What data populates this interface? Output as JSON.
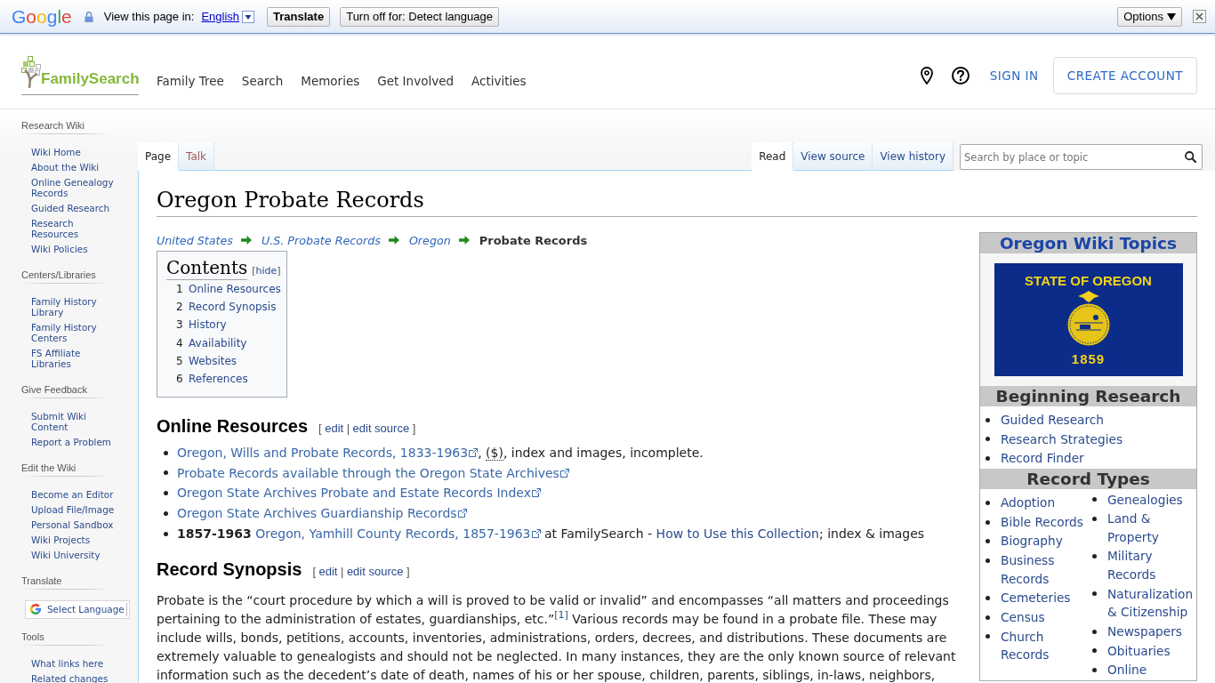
{
  "translate_bar": {
    "logo": "Google",
    "prompt": "View this page in:",
    "language": "English",
    "buttons": [
      {
        "label": "Translate",
        "kind": "translate"
      },
      {
        "label": "Turn off for: Detect language",
        "kind": "turn_off"
      }
    ],
    "options": "Options"
  },
  "header": {
    "logo": "FamilySearch",
    "nav": [
      "Family Tree",
      "Search",
      "Memories",
      "Get Involved",
      "Activities"
    ],
    "sign_in": "SIGN IN",
    "create_account": "CREATE ACCOUNT"
  },
  "sidebar": [
    {
      "heading": "Research Wiki",
      "kind": "links",
      "links": [
        "Wiki Home",
        "About the Wiki",
        "Online Genealogy Records",
        "Guided Research",
        "Research Resources",
        "Wiki Policies"
      ]
    },
    {
      "heading": "Centers/Libraries",
      "kind": "links",
      "links": [
        "Family History Library",
        "Family History Centers",
        "FS Affiliate Libraries"
      ]
    },
    {
      "heading": "Give Feedback",
      "kind": "links",
      "links": [
        "Submit Wiki Content",
        "Report a Problem"
      ]
    },
    {
      "heading": "Edit the Wiki",
      "kind": "links",
      "links": [
        "Become an Editor",
        "Upload File/Image",
        "Personal Sandbox",
        "Wiki Projects",
        "Wiki University"
      ]
    },
    {
      "heading": "Translate",
      "kind": "language_select",
      "label": "Select Language"
    },
    {
      "heading": "Tools",
      "kind": "links",
      "links": [
        "What links here",
        "Related changes"
      ]
    }
  ],
  "page_tabs": [
    {
      "label": "Page",
      "selected": true,
      "exists": true
    },
    {
      "label": "Talk",
      "selected": false,
      "exists": false
    }
  ],
  "view_tabs": [
    {
      "label": "Read",
      "selected": true
    },
    {
      "label": "View source",
      "selected": false
    },
    {
      "label": "View history",
      "selected": false
    }
  ],
  "search": {
    "placeholder": "Search by place or topic"
  },
  "title": "Oregon Probate Records",
  "breadcrumb": [
    {
      "label": "United States",
      "current": false
    },
    {
      "label": "U.S. Probate Records",
      "current": false
    },
    {
      "label": "Oregon",
      "current": false
    },
    {
      "label": "Probate Records",
      "current": true
    }
  ],
  "toc": {
    "title": "Contents",
    "toggle": [
      {
        "kind": "bracket",
        "text": "["
      },
      {
        "kind": "link",
        "text": "hide"
      },
      {
        "kind": "bracket",
        "text": "]"
      }
    ],
    "items": [
      {
        "number": "1",
        "label": "Online Resources"
      },
      {
        "number": "2",
        "label": "Record Synopsis"
      },
      {
        "number": "3",
        "label": "History"
      },
      {
        "number": "4",
        "label": "Availability"
      },
      {
        "number": "5",
        "label": "Websites"
      },
      {
        "number": "6",
        "label": "References"
      }
    ]
  },
  "sections": [
    {
      "heading": "Online Resources",
      "edit_links": [
        {
          "kind": "bracket",
          "text": "["
        },
        {
          "kind": "link",
          "text": "edit"
        },
        {
          "kind": "separator",
          "text": "|"
        },
        {
          "kind": "link",
          "text": "edit source"
        },
        {
          "kind": "bracket",
          "text": "]"
        }
      ],
      "kind": "list",
      "items": [
        {
          "parts": [
            {
              "kind": "external_link",
              "text": "Oregon, Wills and Probate Records, 1833-1963"
            },
            {
              "kind": "text",
              "text": ", "
            },
            {
              "kind": "abbr",
              "text": "($)"
            },
            {
              "kind": "text",
              "text": ", index and images, incomplete."
            }
          ]
        },
        {
          "parts": [
            {
              "kind": "external_link",
              "text": "Probate Records available through the Oregon State Archives"
            }
          ]
        },
        {
          "parts": [
            {
              "kind": "external_link",
              "text": "Oregon State Archives Probate and Estate Records Index"
            }
          ]
        },
        {
          "parts": [
            {
              "kind": "external_link",
              "text": "Oregon State Archives Guardianship Records"
            }
          ]
        },
        {
          "parts": [
            {
              "kind": "bold",
              "text": "1857-1963"
            },
            {
              "kind": "external_link",
              "text": "Oregon, Yamhill County Records, 1857-1963"
            },
            {
              "kind": "text",
              "text": " at FamilySearch - "
            },
            {
              "kind": "link",
              "text": "How to Use this Collection"
            },
            {
              "kind": "text",
              "text": "; index & images"
            }
          ]
        }
      ]
    },
    {
      "heading": "Record Synopsis",
      "edit_links": [
        {
          "kind": "bracket",
          "text": "["
        },
        {
          "kind": "link",
          "text": "edit"
        },
        {
          "kind": "separator",
          "text": "|"
        },
        {
          "kind": "link",
          "text": "edit source"
        },
        {
          "kind": "bracket",
          "text": "]"
        }
      ],
      "kind": "paragraph",
      "parts": [
        {
          "kind": "text",
          "text": "Probate is the “court procedure by which a will is proved to be valid or invalid” and encompasses “all matters and proceedings pertaining to the administration of estates, guardianships, etc.”"
        },
        {
          "kind": "footnote",
          "text": "[1]"
        },
        {
          "kind": "text",
          "text": " Various records may be found in a probate file. These may include wills, bonds, petitions, accounts, inventories, administrations, orders, decrees, and distributions. These documents are extremely valuable to genealogists and should not be neglected. In many instances, they are the only known source of relevant information such as the decedent’s date of death, names of his or her spouse, children, parents, siblings, in-laws, neighbors,"
        }
      ]
    }
  ],
  "infobox": {
    "title": "Oregon Wiki Topics",
    "flag": {
      "top_text": "STATE OF OREGON",
      "bottom_text": "1859"
    },
    "groups": [
      {
        "heading": "Beginning Research",
        "columns": [
          [
            "Guided Research",
            "Research Strategies",
            "Record Finder"
          ]
        ]
      },
      {
        "heading": "Record Types",
        "columns": [
          [
            "Adoption",
            "Bible Records",
            "Biography",
            "Business Records",
            "Cemeteries",
            "Census",
            "Church Records"
          ],
          [
            "Genealogies",
            "Land & Property",
            "Military Records",
            "Naturalization & Citizenship",
            "Newspapers",
            "Obituaries",
            "Online"
          ]
        ]
      }
    ]
  }
}
